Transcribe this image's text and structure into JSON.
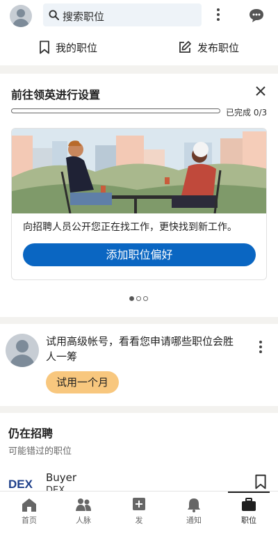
{
  "topbar": {
    "search_placeholder": "搜索职位"
  },
  "jobs_row": {
    "my_jobs": "我的职位",
    "post_job": "发布职位"
  },
  "setup_card": {
    "title": "前往领英进行设置",
    "progress_label": "已完成 0/3",
    "progress_fraction": 0,
    "promo_text": "向招聘人员公开您正在找工作，更快找到新工作。",
    "cta_label": "添加职位偏好",
    "carousel_pages": 3,
    "carousel_active": 0
  },
  "premium_card": {
    "text": "试用高级帐号，看看您申请哪些职位会胜人一筹",
    "button_label": "试用一个月"
  },
  "hiring": {
    "title": "仍在招聘",
    "subtitle": "可能错过的职位",
    "job": {
      "title": "Buyer",
      "company": "DEX",
      "logo_text": "DEX"
    }
  },
  "bottom_nav": {
    "items": [
      {
        "label": "首页",
        "icon": "home-icon"
      },
      {
        "label": "人脉",
        "icon": "network-icon"
      },
      {
        "label": "发",
        "icon": "post-icon"
      },
      {
        "label": "通知",
        "icon": "bell-icon"
      },
      {
        "label": "职位",
        "icon": "briefcase-icon"
      }
    ],
    "active_index": 4
  },
  "colors": {
    "accent": "#0a66c2",
    "premium": "#f8c77e",
    "background_gap": "#f3f2ef"
  }
}
